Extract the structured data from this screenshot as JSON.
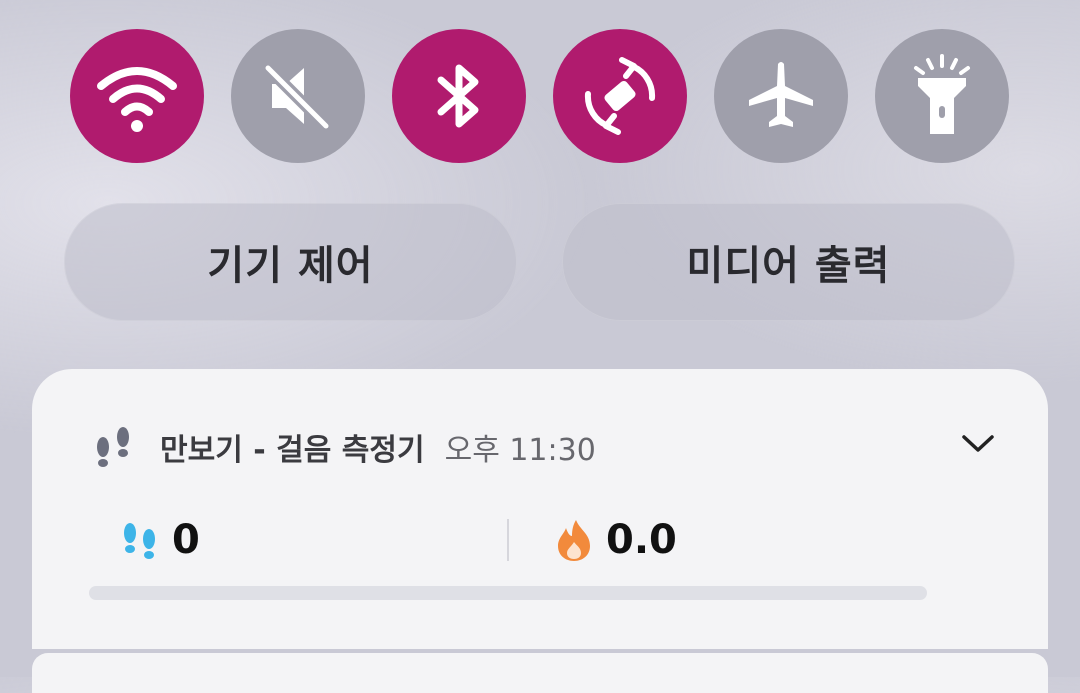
{
  "quick_settings": {
    "toggles": [
      {
        "name": "wifi",
        "icon": "wifi-icon",
        "state": "on"
      },
      {
        "name": "sound",
        "icon": "mute-icon",
        "state": "off"
      },
      {
        "name": "bluetooth",
        "icon": "bluetooth-icon",
        "state": "on"
      },
      {
        "name": "auto-rotate",
        "icon": "rotate-icon",
        "state": "on"
      },
      {
        "name": "airplane-mode",
        "icon": "airplane-icon",
        "state": "off"
      },
      {
        "name": "flashlight",
        "icon": "flashlight-icon",
        "state": "off"
      }
    ],
    "device_control_label": "기기 제어",
    "media_output_label": "미디어 출력"
  },
  "notification": {
    "app_icon": "footprints-icon",
    "app_name": "만보기 - 걸음 측정기",
    "time": "오후 11:30",
    "expand_icon": "chevron-down-icon",
    "steps": {
      "icon": "footprints-icon",
      "value": "0"
    },
    "calories": {
      "icon": "flame-icon",
      "value": "0.0"
    },
    "progress": 0
  },
  "colors": {
    "toggle_on": "#b01b6e",
    "toggle_off": "#9f9fab",
    "steps_icon": "#3db4e8",
    "flame_icon": "#f28a3c"
  }
}
